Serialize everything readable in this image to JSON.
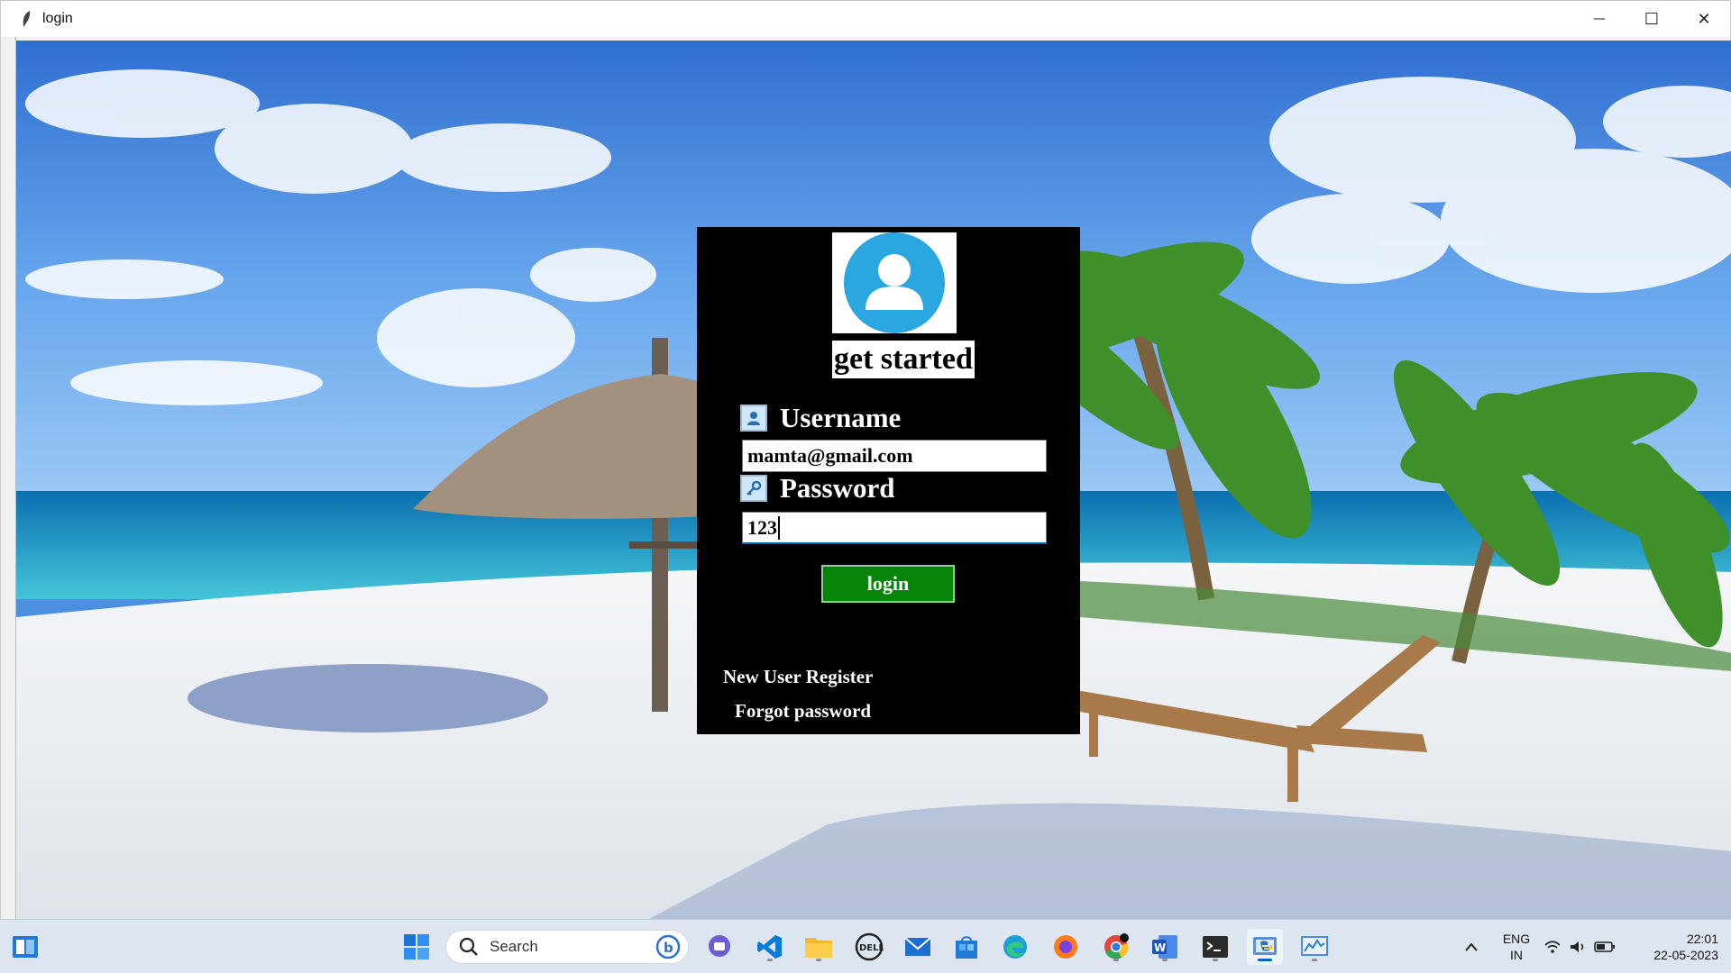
{
  "window": {
    "title": "login",
    "controls": {
      "minimize": "—",
      "maximize": "☐",
      "close": "✕"
    }
  },
  "panel": {
    "heading": "get started",
    "username": {
      "label": "Username",
      "value": "mamta@gmail.com"
    },
    "password": {
      "label": "Password",
      "value": "123"
    },
    "login_label": "login",
    "register_label": "New User Register",
    "forgot_label": "Forgot password"
  },
  "taskbar": {
    "search_placeholder": "Search",
    "apps": [
      "start-icon",
      "copilot-icon",
      "teams-icon",
      "vscode-icon",
      "file-explorer-icon",
      "dell-icon",
      "mail-icon",
      "store-icon",
      "edge-icon",
      "firefox-icon",
      "chrome-icon",
      "word-icon",
      "terminal-icon",
      "python-icon",
      "monitor-icon"
    ],
    "lang_line1": "ENG",
    "lang_line2": "IN",
    "time": "22:01",
    "date": "22-05-2023"
  },
  "colors": {
    "panel_bg": "#000000",
    "login_button": "#07850b",
    "avatar_circle": "#2aa7e0",
    "taskbar": "#dde6f0"
  }
}
